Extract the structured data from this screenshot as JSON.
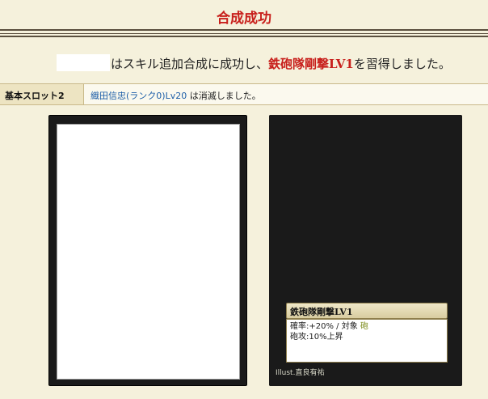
{
  "header": {
    "title": "合成成功"
  },
  "message": {
    "before": "はスキル追加合成に成功し、",
    "skill": "鉄砲隊剛撃LV1",
    "after": "を習得しました。"
  },
  "slot_row": {
    "label": "基本スロット2",
    "card_link": "織田信忠(ランク0)Lv20",
    "suffix": " は消滅しました。"
  },
  "result_card": {
    "skill_name": "鉄砲隊剛撃LV1",
    "rate_line": "確率:+20% / 対象",
    "target": "砲",
    "effect_line": "砲攻:10%上昇",
    "illust": "Illust.直良有祐"
  }
}
